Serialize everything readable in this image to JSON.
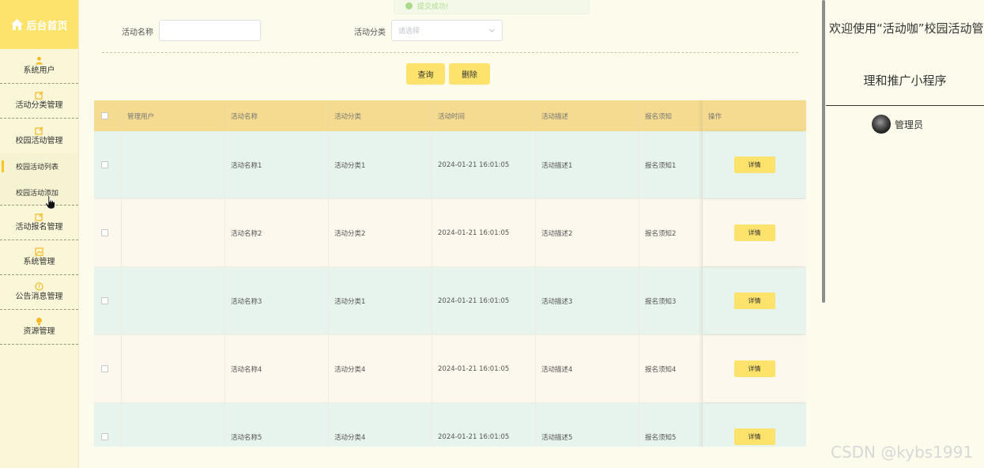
{
  "sidebar": {
    "title": "后台首页",
    "items": [
      {
        "label": "系统用户",
        "icon": "user-icon"
      },
      {
        "label": "活动分类管理",
        "icon": "edit-icon"
      },
      {
        "label": "校园活动管理",
        "icon": "edit-icon"
      },
      {
        "label": "活动报名管理",
        "icon": "edit-icon"
      },
      {
        "label": "系统管理",
        "icon": "image-icon"
      },
      {
        "label": "公告消息管理",
        "icon": "info-icon"
      },
      {
        "label": "资源管理",
        "icon": "bulb-icon"
      }
    ],
    "subitems": [
      {
        "label": "校园活动列表",
        "active": true
      },
      {
        "label": "校园活动添加",
        "active": false
      }
    ]
  },
  "toast": {
    "text": "提交成功!"
  },
  "search": {
    "name_label": "活动名称",
    "name_value": "",
    "category_label": "活动分类",
    "category_placeholder": "请选择"
  },
  "buttons": {
    "query": "查询",
    "delete": "删除"
  },
  "table": {
    "headers": [
      "",
      "管理用户",
      "活动名称",
      "活动分类",
      "活动时间",
      "活动描述",
      "报名须知",
      "操作"
    ],
    "rows": [
      {
        "user": "",
        "name": "活动名称1",
        "category": "活动分类1",
        "time": "2024-01-21 16:01:05",
        "desc": "活动描述1",
        "notice": "报名须知1",
        "action": "详情"
      },
      {
        "user": "",
        "name": "活动名称2",
        "category": "活动分类2",
        "time": "2024-01-21 16:01:05",
        "desc": "活动描述2",
        "notice": "报名须知2",
        "action": "详情"
      },
      {
        "user": "",
        "name": "活动名称3",
        "category": "活动分类1",
        "time": "2024-01-21 16:01:05",
        "desc": "活动描述3",
        "notice": "报名须知3",
        "action": "详情"
      },
      {
        "user": "",
        "name": "活动名称4",
        "category": "活动分类4",
        "time": "2024-01-21 16:01:05",
        "desc": "活动描述4",
        "notice": "报名须知4",
        "action": "详情"
      },
      {
        "user": "",
        "name": "活动名称5",
        "category": "活动分类4",
        "time": "2024-01-21 16:01:05",
        "desc": "活动描述5",
        "notice": "报名须知5",
        "action": "详情"
      }
    ]
  },
  "right_panel": {
    "welcome_line1": "欢迎使用“活动咖”校园活动管",
    "welcome_line2": "理和推广小程序",
    "admin_name": "管理员",
    "watermark": "CSDN @kybs1991"
  },
  "colors": {
    "accent": "#fde36b",
    "sidebar_bg": "#faf7d8",
    "table_header": "#f5db90",
    "row_green": "#e7f4ed",
    "row_cream": "#fcf8ed",
    "active_marker": "#f7c626"
  }
}
